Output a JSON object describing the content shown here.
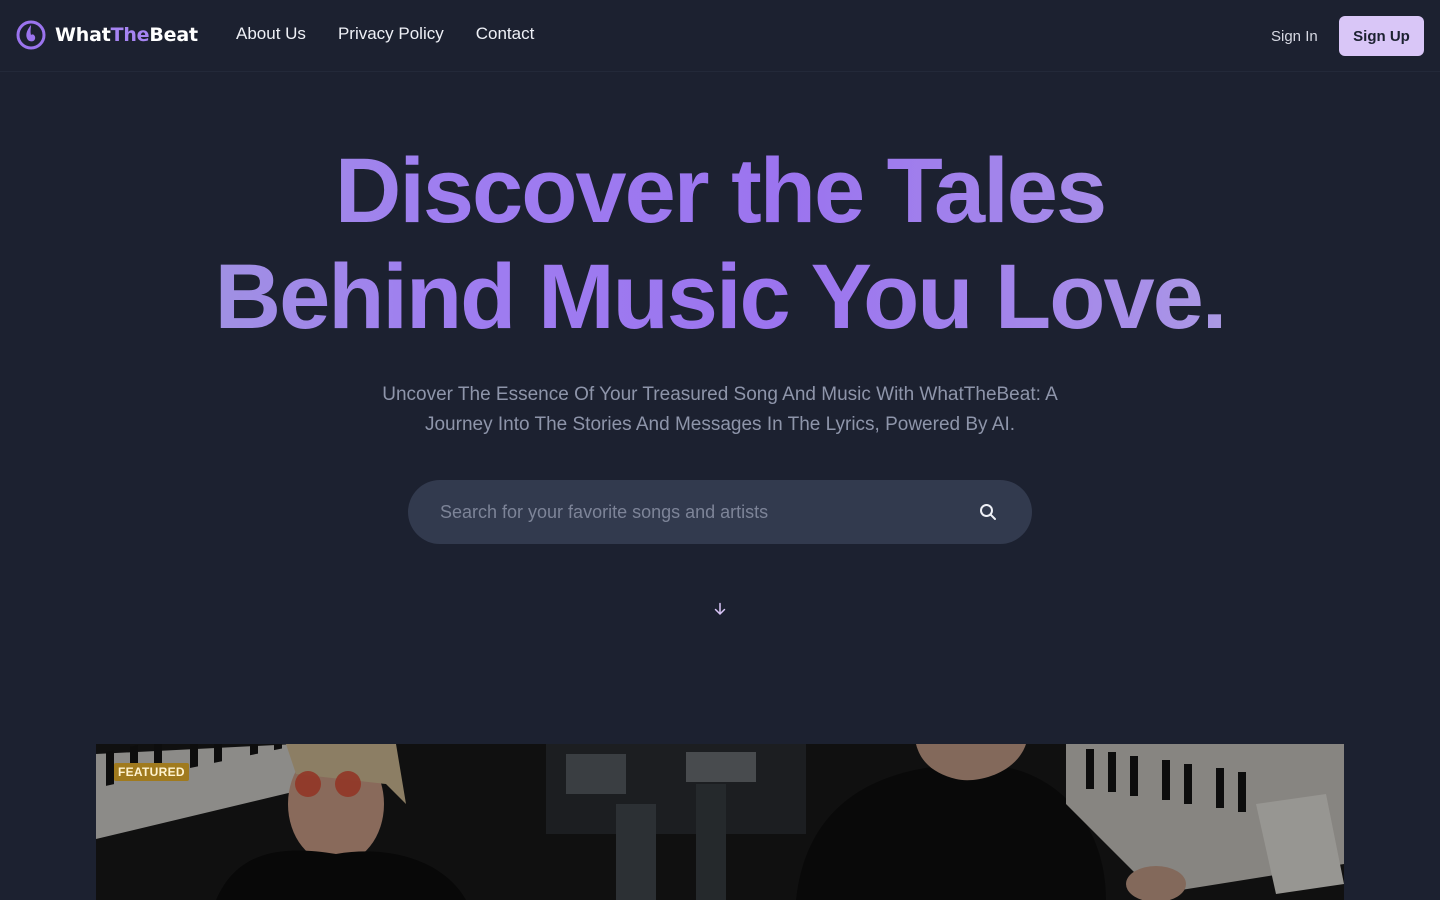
{
  "brand": {
    "name_part1": "What",
    "name_part2": "The",
    "name_part3": "Beat",
    "accent_color": "#a684f2"
  },
  "nav": {
    "links": [
      {
        "label": "About Us"
      },
      {
        "label": "Privacy Policy"
      },
      {
        "label": "Contact"
      }
    ],
    "sign_in_label": "Sign In",
    "sign_up_label": "Sign Up",
    "sign_up_bg": "#d9c6f7"
  },
  "hero": {
    "title_line1": "Discover the Tales",
    "title_line2": "Behind Music You Love.",
    "subtitle": "Uncover The Essence Of Your Treasured Song And Music With WhatTheBeat: A Journey Into The Stories And Messages In The Lyrics, Powered By AI."
  },
  "search": {
    "placeholder": "Search for your favorite songs and artists",
    "value": "",
    "icon": "search-icon"
  },
  "scroll_icon": "arrow-down-icon",
  "featured": {
    "badge": "FEATURED",
    "badge_color": "#a07a1e"
  },
  "colors": {
    "background": "#1c2130",
    "search_bg": "#323a4e"
  }
}
